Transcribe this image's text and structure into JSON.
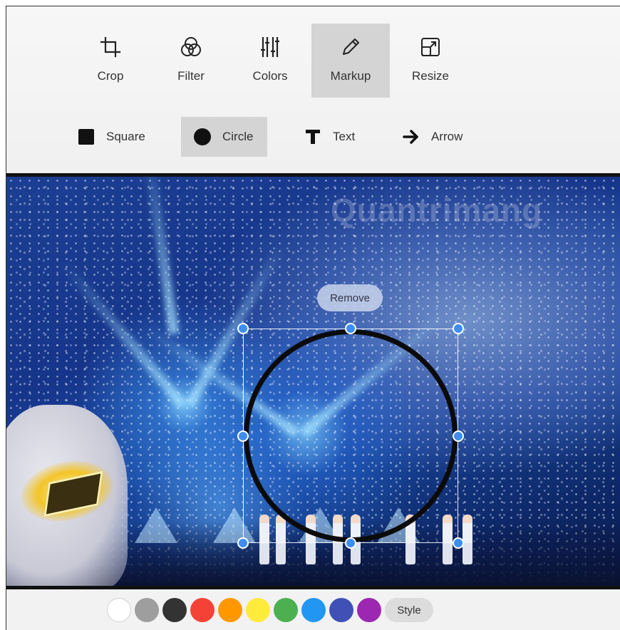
{
  "toolbar": {
    "tools": [
      {
        "label": "Crop",
        "icon": "crop-icon"
      },
      {
        "label": "Filter",
        "icon": "filter-icon"
      },
      {
        "label": "Colors",
        "icon": "sliders-icon"
      },
      {
        "label": "Markup",
        "icon": "pencil-icon",
        "active": true
      },
      {
        "label": "Resize",
        "icon": "resize-icon"
      }
    ]
  },
  "markup": {
    "shapes": [
      {
        "label": "Square",
        "icon": "square-icon"
      },
      {
        "label": "Circle",
        "icon": "circle-icon",
        "active": true
      },
      {
        "label": "Text",
        "icon": "text-icon"
      },
      {
        "label": "Arrow",
        "icon": "arrow-right-icon"
      }
    ],
    "remove_label": "Remove",
    "style_label": "Style"
  },
  "palette": {
    "colors": [
      "#ffffff",
      "#9e9e9e",
      "#333333",
      "#f44336",
      "#ff9800",
      "#ffeb3b",
      "#4caf50",
      "#2196f3",
      "#3f51b5",
      "#9c27b0"
    ]
  },
  "canvas": {
    "watermark": "Quantrimang"
  }
}
